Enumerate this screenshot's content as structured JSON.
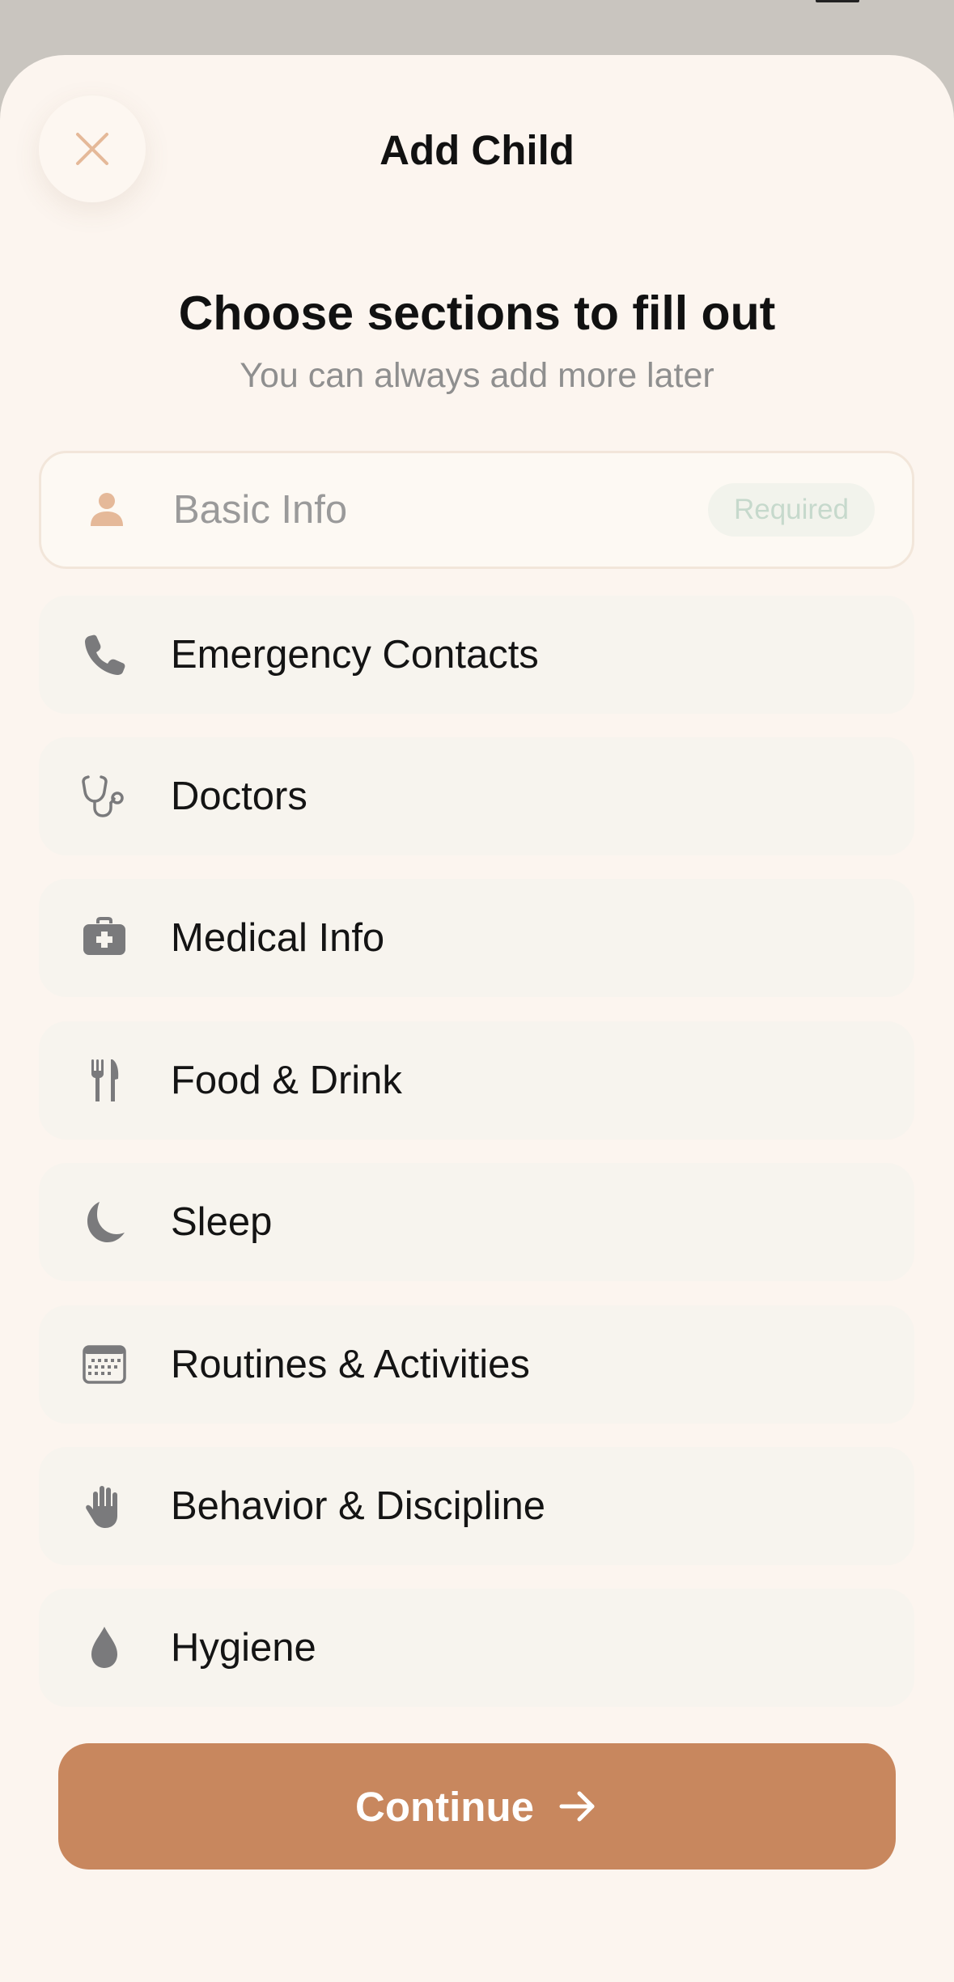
{
  "header": {
    "title": "Add Child",
    "close_icon": "close-icon"
  },
  "intro": {
    "heading": "Choose sections to fill out",
    "subheading": "You can always add more later"
  },
  "sections": [
    {
      "label": "Basic Info",
      "icon": "person-icon",
      "badge": "Required",
      "required": true
    },
    {
      "label": "Emergency Contacts",
      "icon": "phone-icon",
      "required": false
    },
    {
      "label": "Doctors",
      "icon": "stethoscope-icon",
      "required": false
    },
    {
      "label": "Medical Info",
      "icon": "medical-kit-icon",
      "required": false
    },
    {
      "label": "Food & Drink",
      "icon": "fork-knife-icon",
      "required": false
    },
    {
      "label": "Sleep",
      "icon": "moon-icon",
      "required": false
    },
    {
      "label": "Routines & Activities",
      "icon": "calendar-icon",
      "required": false
    },
    {
      "label": "Behavior & Discipline",
      "icon": "hand-icon",
      "required": false
    },
    {
      "label": "Hygiene",
      "icon": "drop-icon",
      "required": false
    }
  ],
  "footer": {
    "continue_label": "Continue",
    "continue_icon": "arrow-right-icon"
  },
  "colors": {
    "sheet_background": "#fcf5ef",
    "accent": "#c8875e",
    "icon_gray": "#7a7a7c",
    "required_icon": "#e5b999",
    "badge_text": "#c6d9cc"
  }
}
